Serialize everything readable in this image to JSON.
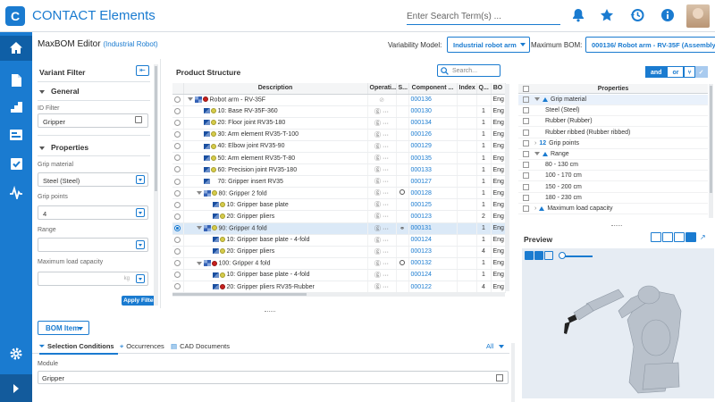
{
  "app": {
    "title": "CONTACT Elements",
    "logo_letter": "C",
    "search_placeholder": "Enter Search Term(s) ..."
  },
  "header": {
    "title": "MaxBOM Editor",
    "subtitle": "(Industrial Robot)",
    "variability_label": "Variability Model:",
    "variability_value": "Industrial robot arm",
    "maxbom_label": "Maximum BOM:",
    "maxbom_value": "000136/ Robot arm - RV-35F (Assembly)"
  },
  "variant_filter": {
    "title": "Variant Filter",
    "general_label": "General",
    "id_filter_label": "ID Filter",
    "id_filter_value": "Gripper",
    "properties_label": "Properties",
    "fields": [
      {
        "label": "Grip material",
        "value": "Steel (Steel)"
      },
      {
        "label": "Grip points",
        "value": "4"
      },
      {
        "label": "Range",
        "value": ""
      },
      {
        "label": "Maximum load capacity",
        "value": "",
        "unit": "kg"
      }
    ],
    "apply_label": "Apply Filter"
  },
  "product_structure": {
    "title": "Product Structure",
    "search_placeholder": "Search...",
    "columns": [
      "Description",
      "Operati...",
      "S...",
      "Component ...",
      "Index",
      "Q...",
      "BO"
    ],
    "rows": [
      {
        "level": 0,
        "expand": true,
        "icon": "asm",
        "dot": "red",
        "desc": "Robot arm - RV-35F",
        "op": "",
        "status": "",
        "comp": "000136",
        "index": "",
        "qty": "",
        "bo": "Eng",
        "selected": false
      },
      {
        "level": 1,
        "expand": false,
        "icon": "part",
        "dot": "yellow",
        "desc": "10: Base RV-35F-360",
        "op": "···",
        "status": "",
        "comp": "000130",
        "index": "",
        "qty": "1",
        "bo": "Eng",
        "selected": false
      },
      {
        "level": 1,
        "expand": false,
        "icon": "part",
        "dot": "yellow",
        "desc": "20: Floor joint RV35-180",
        "op": "···",
        "status": "",
        "comp": "000134",
        "index": "",
        "qty": "1",
        "bo": "Eng",
        "selected": false
      },
      {
        "level": 1,
        "expand": false,
        "icon": "part",
        "dot": "yellow",
        "desc": "30: Arm element RV35-T-100",
        "op": "···",
        "status": "",
        "comp": "000126",
        "index": "",
        "qty": "1",
        "bo": "Eng",
        "selected": false
      },
      {
        "level": 1,
        "expand": false,
        "icon": "part",
        "dot": "yellow",
        "desc": "40: Elbow joint RV35-90",
        "op": "···",
        "status": "",
        "comp": "000129",
        "index": "",
        "qty": "1",
        "bo": "Eng",
        "selected": false
      },
      {
        "level": 1,
        "expand": false,
        "icon": "part",
        "dot": "yellow",
        "desc": "50: Arm element RV35-T-80",
        "op": "···",
        "status": "",
        "comp": "000135",
        "index": "",
        "qty": "1",
        "bo": "Eng",
        "selected": false
      },
      {
        "level": 1,
        "expand": false,
        "icon": "part",
        "dot": "yellow",
        "desc": "60: Precision joint RV35-180",
        "op": "···",
        "status": "",
        "comp": "000133",
        "index": "",
        "qty": "1",
        "bo": "Eng",
        "selected": false
      },
      {
        "level": 1,
        "expand": false,
        "icon": "part",
        "dot": "",
        "desc": "70: Gripper insert RV35",
        "op": "···",
        "status": "",
        "comp": "000127",
        "index": "",
        "qty": "1",
        "bo": "Eng",
        "selected": false
      },
      {
        "level": 1,
        "expand": true,
        "icon": "asm",
        "dot": "yellow",
        "desc": "80: Gripper 2 fold",
        "op": "···",
        "status": "circle",
        "comp": "000128",
        "index": "",
        "qty": "1",
        "bo": "Eng",
        "selected": false
      },
      {
        "level": 2,
        "expand": false,
        "icon": "part",
        "dot": "yellow",
        "desc": "10: Gripper base plate",
        "op": "···",
        "status": "",
        "comp": "000125",
        "index": "",
        "qty": "1",
        "bo": "Eng",
        "selected": false
      },
      {
        "level": 2,
        "expand": false,
        "icon": "part",
        "dot": "yellow",
        "desc": "20: Gripper pliers",
        "op": "···",
        "status": "",
        "comp": "000123",
        "index": "",
        "qty": "2",
        "bo": "Eng",
        "selected": false
      },
      {
        "level": 1,
        "expand": true,
        "icon": "asm",
        "dot": "yellow",
        "desc": "90: Gripper 4 fold",
        "op": "···",
        "status": "link",
        "comp": "000131",
        "index": "",
        "qty": "1",
        "bo": "Eng",
        "selected": true
      },
      {
        "level": 2,
        "expand": false,
        "icon": "part",
        "dot": "yellow",
        "desc": "10: Gripper base plate - 4-fold",
        "op": "···",
        "status": "",
        "comp": "000124",
        "index": "",
        "qty": "1",
        "bo": "Eng",
        "selected": false
      },
      {
        "level": 2,
        "expand": false,
        "icon": "part",
        "dot": "yellow",
        "desc": "20: Gripper pliers",
        "op": "···",
        "status": "",
        "comp": "000123",
        "index": "",
        "qty": "4",
        "bo": "Eng",
        "selected": false
      },
      {
        "level": 1,
        "expand": true,
        "icon": "asm",
        "dot": "red",
        "desc": "100: Gripper 4 fold",
        "op": "···",
        "status": "circle",
        "comp": "000132",
        "index": "",
        "qty": "1",
        "bo": "Eng",
        "selected": false
      },
      {
        "level": 2,
        "expand": false,
        "icon": "part",
        "dot": "yellow",
        "desc": "10: Gripper base plate - 4-fold",
        "op": "···",
        "status": "",
        "comp": "000124",
        "index": "",
        "qty": "1",
        "bo": "Eng",
        "selected": false
      },
      {
        "level": 2,
        "expand": false,
        "icon": "part",
        "dot": "red",
        "desc": "20: Gripper pliers RV35-Rubber",
        "op": "···",
        "status": "",
        "comp": "000122",
        "index": "",
        "qty": "4",
        "bo": "Eng",
        "selected": false
      }
    ]
  },
  "properties": {
    "and_label": "and",
    "or_label": "or",
    "header": "Properties",
    "rows": [
      {
        "indent": 0,
        "kind": "group-open",
        "text": "Grip material",
        "selected": true
      },
      {
        "indent": 1,
        "kind": "value",
        "text": "Steel (Steel)",
        "selected": false
      },
      {
        "indent": 1,
        "kind": "value",
        "text": "Rubber (Rubber)",
        "selected": false
      },
      {
        "indent": 1,
        "kind": "value",
        "text": "Rubber ribbed (Rubber ribbed)",
        "selected": false
      },
      {
        "indent": 0,
        "kind": "group-closed-num",
        "text": "Grip points",
        "selected": false
      },
      {
        "indent": 0,
        "kind": "group-open",
        "text": "Range",
        "selected": false
      },
      {
        "indent": 1,
        "kind": "value",
        "text": "80 - 130 cm",
        "selected": false
      },
      {
        "indent": 1,
        "kind": "value",
        "text": "100 - 170 cm",
        "selected": false
      },
      {
        "indent": 1,
        "kind": "value",
        "text": "150 - 200 cm",
        "selected": false
      },
      {
        "indent": 1,
        "kind": "value",
        "text": "180 - 230 cm",
        "selected": false
      },
      {
        "indent": 0,
        "kind": "group-closed",
        "text": "Maximum load capacity",
        "selected": false
      }
    ]
  },
  "preview": {
    "title": "Preview"
  },
  "bottom": {
    "bom_item_label": "BOM Item",
    "tabs": [
      "Selection Conditions",
      "Occurrences",
      "CAD Documents"
    ],
    "all_label": "All",
    "module_label": "Module",
    "module_value": "Gripper"
  },
  "colors": {
    "accent": "#1a7bd0",
    "nav_bg": "#1a7bd0",
    "selected_row": "#dbe9f7"
  }
}
